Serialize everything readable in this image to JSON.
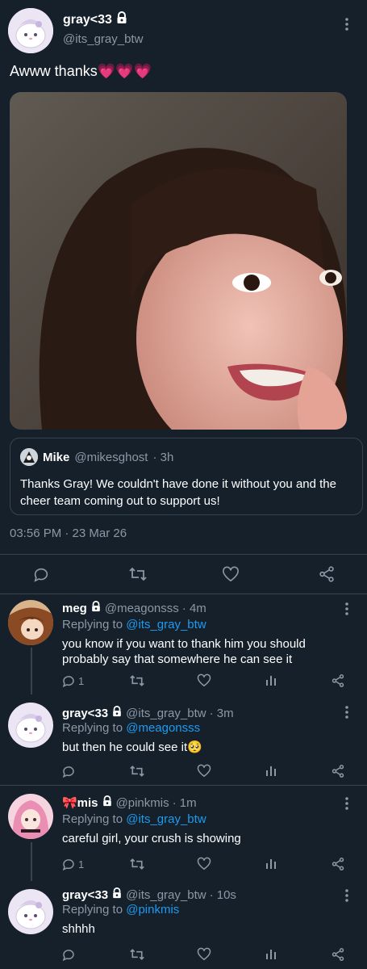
{
  "main": {
    "display_name": "gray<33",
    "handle": "@its_gray_btw",
    "text": "Awww thanks💗💗💗",
    "quoted": {
      "name": "Mike",
      "handle": "@mikesghost",
      "time": "· 3h",
      "text": "Thanks Gray! We couldn't have done it without you and the cheer team coming out to support us!"
    },
    "timestamp": "03:56 PM · 23 Mar 26"
  },
  "replies": [
    {
      "name": "meg",
      "handle": "@meagonsss",
      "time": "· 4m",
      "replying_label": "Replying to",
      "replying_to": "@its_gray_btw",
      "text": "you know if you want to thank him you should probably say that somewhere he can see it",
      "reply_count": "1"
    },
    {
      "name": "gray<33",
      "handle": "@its_gray_btw",
      "time": "· 3m",
      "replying_label": "Replying to",
      "replying_to": "@meagonsss",
      "text": "but then he could see it🥺",
      "reply_count": ""
    },
    {
      "name": "🎀mis",
      "handle": "@pinkmis",
      "time": "· 1m",
      "replying_label": "Replying to",
      "replying_to": "@its_gray_btw",
      "text": "careful girl, your crush is showing",
      "reply_count": "1"
    },
    {
      "name": "gray<33",
      "handle": "@its_gray_btw",
      "time": "· 10s",
      "replying_label": "Replying to",
      "replying_to": "@pinkmis",
      "text": "shhhh",
      "reply_count": ""
    }
  ],
  "colors": {
    "background": "#15202b",
    "divider": "#38444d",
    "muted_text": "#8b98a5",
    "link": "#1d9bf0"
  },
  "icons": [
    "lock-icon",
    "more-icon",
    "reply-icon",
    "retweet-icon",
    "like-icon",
    "share-icon",
    "analytics-icon"
  ]
}
